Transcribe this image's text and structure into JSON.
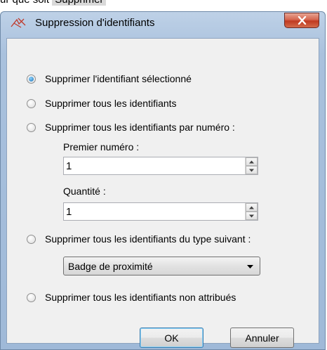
{
  "background": {
    "text_prefix": "ur que soit",
    "text_highlight": "Supprimer"
  },
  "window": {
    "title": "Suppression d'identifiants",
    "close_glyph": "x"
  },
  "options": [
    {
      "label": "Supprimer l'identifiant sélectionné",
      "checked": true
    },
    {
      "label": "Supprimer tous les identifiants",
      "checked": false
    },
    {
      "label": "Supprimer tous les identifiants par numéro :",
      "checked": false
    },
    {
      "label": "Supprimer tous les identifiants du type suivant :",
      "checked": false
    },
    {
      "label": "Supprimer tous les identifiants non attribués",
      "checked": false
    }
  ],
  "first_number": {
    "label": "Premier numéro :",
    "value": "1"
  },
  "quantity": {
    "label": "Quantité :",
    "value": "1"
  },
  "type_select": {
    "value": "Badge de proximité"
  },
  "buttons": {
    "ok": "OK",
    "cancel": "Annuler"
  }
}
